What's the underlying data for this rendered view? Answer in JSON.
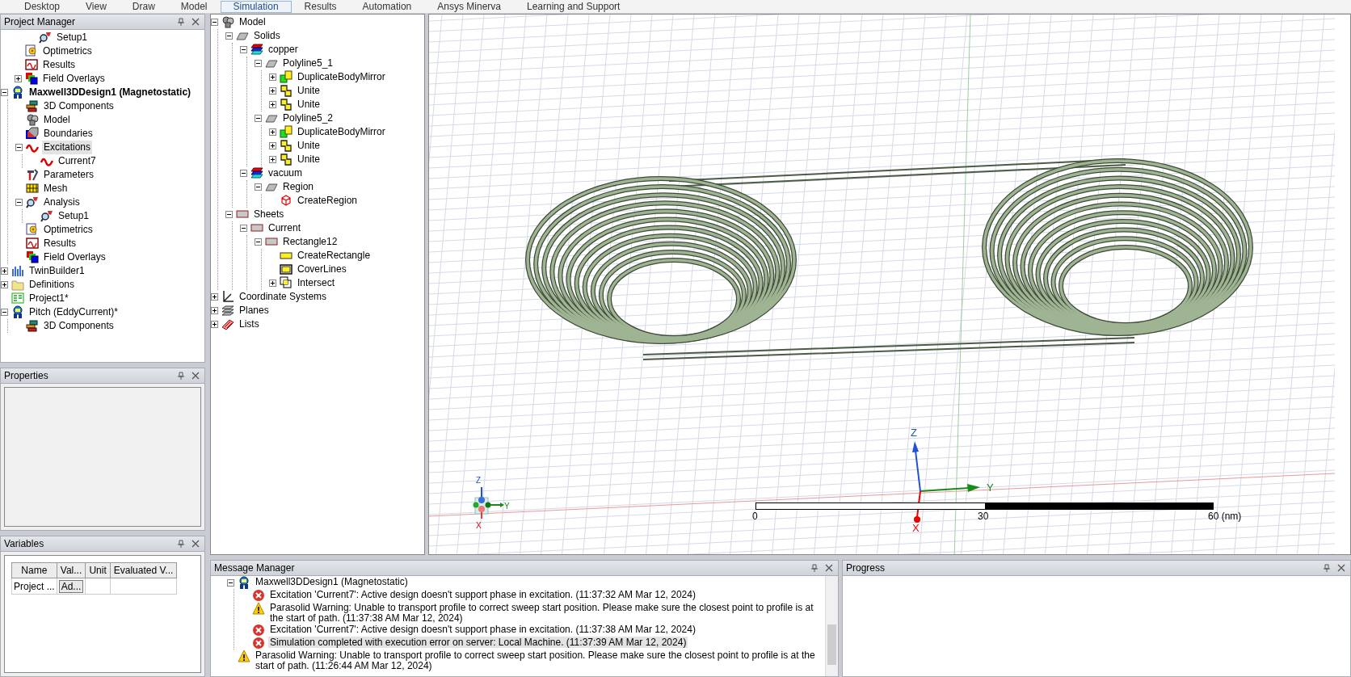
{
  "ribbon_tabs": [
    {
      "label": "Desktop",
      "selected": false
    },
    {
      "label": "View",
      "selected": false
    },
    {
      "label": "Draw",
      "selected": false
    },
    {
      "label": "Model",
      "selected": false
    },
    {
      "label": "Simulation",
      "selected": true
    },
    {
      "label": "Results",
      "selected": false
    },
    {
      "label": "Automation",
      "selected": false
    },
    {
      "label": "Ansys Minerva",
      "selected": false
    },
    {
      "label": "Learning and Support",
      "selected": false
    }
  ],
  "project_manager": {
    "title": "Project Manager",
    "tree": [
      {
        "children": [
          {
            "children": [
              {
                "label": "Setup1",
                "kind": "setup",
                "selected": false
              }
            ]
          },
          {
            "label": "Optimetrics",
            "kind": "optimetrics",
            "selected": false
          },
          {
            "label": "Results",
            "kind": "results",
            "selected": false
          },
          {
            "label": "Field Overlays",
            "kind": "overlays",
            "expanded": false,
            "selected": false
          }
        ]
      },
      {
        "label": "Maxwell3DDesign1 (Magnetostatic)",
        "kind": "design",
        "bold": true,
        "expanded": true,
        "selected": false,
        "children": [
          {
            "label": "3D Components",
            "kind": "components",
            "selected": false
          },
          {
            "label": "Model",
            "kind": "model",
            "selected": false
          },
          {
            "label": "Boundaries",
            "kind": "boundaries",
            "selected": false
          },
          {
            "label": "Excitations",
            "kind": "excitation",
            "expanded": true,
            "selected": true,
            "children": [
              {
                "label": "Current7",
                "kind": "excitation",
                "selected": false
              }
            ]
          },
          {
            "label": "Parameters",
            "kind": "parameters",
            "selected": false
          },
          {
            "label": "Mesh",
            "kind": "mesh",
            "selected": false
          },
          {
            "label": "Analysis",
            "kind": "setup",
            "expanded": true,
            "selected": false,
            "children": [
              {
                "label": "Setup1",
                "kind": "setup",
                "selected": false
              }
            ]
          },
          {
            "label": "Optimetrics",
            "kind": "optimetrics",
            "selected": false
          },
          {
            "label": "Results",
            "kind": "results",
            "selected": false
          },
          {
            "label": "Field Overlays",
            "kind": "overlays",
            "selected": false
          }
        ]
      },
      {
        "label": "TwinBuilder1",
        "kind": "twinbuilder",
        "expanded": false,
        "selected": false
      },
      {
        "label": "Definitions",
        "kind": "folder",
        "expanded": false,
        "selected": false
      },
      {
        "label": "Project1*",
        "kind": "project",
        "selected": false
      },
      {
        "label": "Pitch (EddyCurrent)*",
        "kind": "design",
        "expanded": true,
        "selected": false,
        "children": [
          {
            "label": "3D Components",
            "kind": "components",
            "selected": false
          }
        ]
      }
    ]
  },
  "properties": {
    "title": "Properties"
  },
  "variables": {
    "title": "Variables",
    "columns": [
      "Name",
      "Val...",
      "Unit",
      "Evaluated V..."
    ],
    "rows": [
      {
        "name": "Project ...",
        "value": "Ad..."
      }
    ]
  },
  "model_tree": [
    {
      "label": "Model",
      "kind": "model",
      "expanded": true,
      "children": [
        {
          "label": "Solids",
          "kind": "solid",
          "expanded": true,
          "children": [
            {
              "label": "copper",
              "kind": "material",
              "expanded": true,
              "children": [
                {
                  "label": "Polyline5_1",
                  "kind": "solid",
                  "expanded": true,
                  "children": [
                    {
                      "label": "DuplicateBodyMirror",
                      "kind": "mirror",
                      "expanded": false
                    },
                    {
                      "label": "Unite",
                      "kind": "unite",
                      "expanded": false
                    },
                    {
                      "label": "Unite",
                      "kind": "unite",
                      "expanded": false
                    }
                  ]
                },
                {
                  "label": "Polyline5_2",
                  "kind": "solid",
                  "expanded": true,
                  "children": [
                    {
                      "label": "DuplicateBodyMirror",
                      "kind": "mirror",
                      "expanded": false
                    },
                    {
                      "label": "Unite",
                      "kind": "unite",
                      "expanded": false
                    },
                    {
                      "label": "Unite",
                      "kind": "unite",
                      "expanded": false
                    }
                  ]
                }
              ]
            },
            {
              "label": "vacuum",
              "kind": "material",
              "expanded": true,
              "children": [
                {
                  "label": "Region",
                  "kind": "solid",
                  "expanded": true,
                  "children": [
                    {
                      "label": "CreateRegion",
                      "kind": "region"
                    }
                  ]
                }
              ]
            }
          ]
        },
        {
          "label": "Sheets",
          "kind": "sheet",
          "expanded": true,
          "children": [
            {
              "label": "Current",
              "kind": "sheet",
              "expanded": true,
              "children": [
                {
                  "label": "Rectangle12",
                  "kind": "sheet",
                  "expanded": true,
                  "children": [
                    {
                      "label": "CreateRectangle",
                      "kind": "createrect"
                    },
                    {
                      "label": "CoverLines",
                      "kind": "cover"
                    },
                    {
                      "label": "Intersect",
                      "kind": "intersect",
                      "expanded": false
                    }
                  ]
                }
              ]
            }
          ]
        }
      ]
    },
    {
      "label": "Coordinate Systems",
      "kind": "coords",
      "expanded": false
    },
    {
      "label": "Planes",
      "kind": "planes",
      "expanded": false
    },
    {
      "label": "Lists",
      "kind": "lists",
      "expanded": false
    }
  ],
  "viewport": {
    "triad": {
      "z": "Z",
      "y": "Y",
      "x": "X"
    },
    "mini_triad": {
      "z": "Z",
      "y": "Y",
      "x": "X"
    },
    "scale_labels": [
      "0",
      "30",
      "60 (nm)"
    ]
  },
  "message_manager": {
    "title": "Message Manager",
    "tree": [
      {
        "label": "Maxwell3DDesign1 (Magnetostatic)",
        "kind": "design",
        "expanded": true,
        "selected": false,
        "children": [
          {
            "label": "Excitation 'Current7': Active design doesn't support phase in excitation. (11:37:32 AM  Mar 12, 2024)",
            "kind": "error",
            "selected": false
          },
          {
            "label": "Parasolid Warning: Unable to transport profile to correct sweep start position. Please make sure the closest point to profile is at the start of path. (11:37:38 AM  Mar 12, 2024)",
            "kind": "warning",
            "selected": false
          },
          {
            "label": "Excitation 'Current7': Active design doesn't support phase in excitation. (11:37:38 AM  Mar 12, 2024)",
            "kind": "error",
            "selected": false
          },
          {
            "label": "Simulation completed with execution error on server: Local Machine. (11:37:39 AM  Mar 12, 2024)",
            "kind": "error",
            "selected": true
          }
        ]
      },
      {
        "label": "Parasolid Warning: Unable to transport profile to correct sweep start position. Please make sure the closest point to profile is at the start of path. (11:26:44 AM  Mar 12, 2024)",
        "kind": "warning",
        "selected": false
      }
    ]
  },
  "progress": {
    "title": "Progress"
  }
}
